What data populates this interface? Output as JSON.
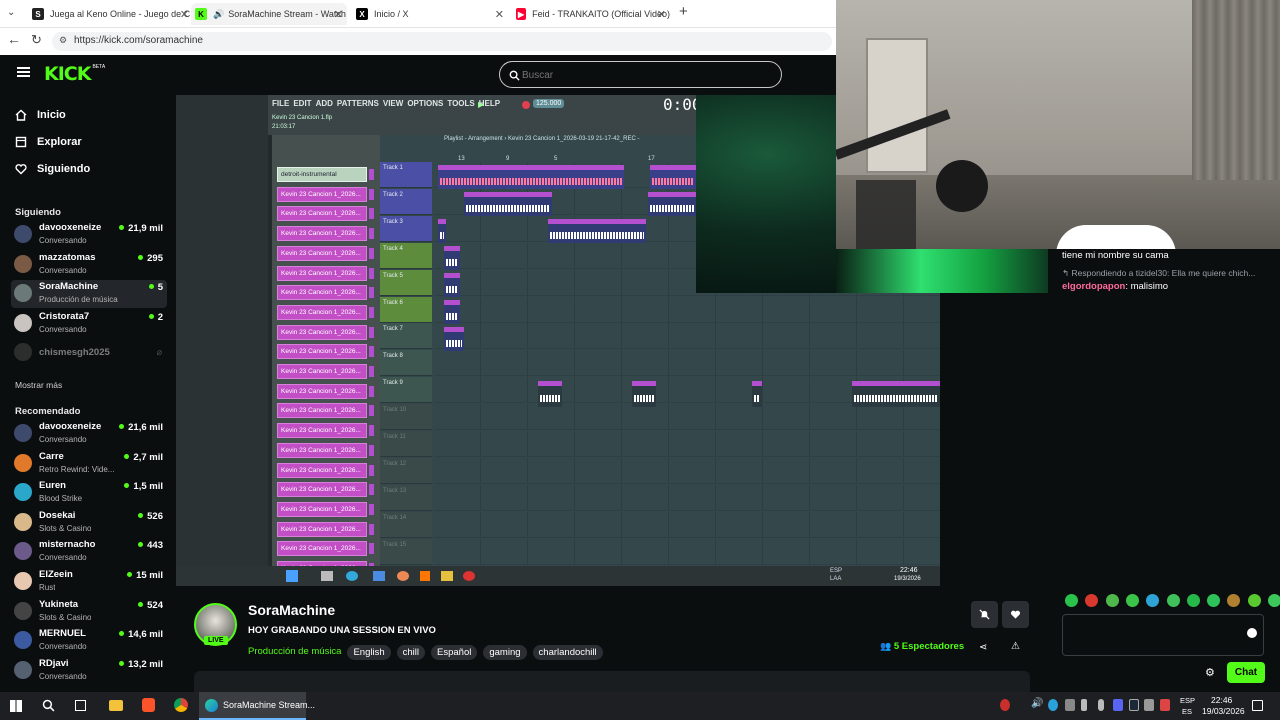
{
  "browser": {
    "tabs": [
      {
        "title": "Juega al Keno Online - Juego de C",
        "favicon_color": "#222222",
        "active": false
      },
      {
        "title": "SoraMachine Stream - Watch",
        "favicon_color": "#53fc18",
        "active": true
      },
      {
        "title": "Inicio / X",
        "favicon_color": "#000000",
        "active": false
      },
      {
        "title": "Feid - TRANKAITO (Official Video)",
        "favicon_color": "#ff0033",
        "active": false
      }
    ],
    "url": "https://kick.com/soramachine",
    "new_tab_icon": "plus-icon"
  },
  "kick": {
    "logo": "KICK",
    "logo_badge": "BETA",
    "search_placeholder": "Buscar",
    "accent": "#53fc18"
  },
  "sidebar": {
    "nav": [
      {
        "label": "Inicio",
        "icon": "home-icon"
      },
      {
        "label": "Explorar",
        "icon": "compass-icon"
      },
      {
        "label": "Siguiendo",
        "icon": "heart-icon"
      }
    ],
    "following_title": "Siguiendo",
    "following": [
      {
        "name": "davooxeneize",
        "sub": "Conversando",
        "count": "21,9 mil",
        "avatar_color": "#3d4a6b"
      },
      {
        "name": "mazzatomas",
        "sub": "Conversando",
        "count": "295",
        "avatar_color": "#7a5a44"
      },
      {
        "name": "SoraMachine",
        "sub": "Producción de música",
        "count": "5",
        "avatar_color": "#6b7a78",
        "selected": true
      },
      {
        "name": "Cristorata7",
        "sub": "Conversando",
        "count": "2",
        "avatar_color": "#c9c4c0"
      },
      {
        "name": "chismesgh2025",
        "sub": "",
        "count": "",
        "avatar_color": "#555555",
        "offline": true
      }
    ],
    "show_more": "Mostrar más",
    "recommended_title": "Recomendado",
    "recommended": [
      {
        "name": "davooxeneize",
        "sub": "Conversando",
        "count": "21,6 mil",
        "avatar_color": "#3d4a6b"
      },
      {
        "name": "Carre",
        "sub": "Retro Rewind: Vide...",
        "count": "2,7 mil",
        "avatar_color": "#e07a2a"
      },
      {
        "name": "Euren",
        "sub": "Blood Strike",
        "count": "1,5 mil",
        "avatar_color": "#2aa7c9"
      },
      {
        "name": "Dosekai",
        "sub": "Slots & Casino",
        "count": "526",
        "avatar_color": "#d9b98a"
      },
      {
        "name": "misternacho",
        "sub": "Conversando",
        "count": "443",
        "avatar_color": "#6b5a8a"
      },
      {
        "name": "ElZeein",
        "sub": "Rust",
        "count": "15 mil",
        "avatar_color": "#e8c8b0"
      },
      {
        "name": "Yukineta",
        "sub": "Slots & Casino",
        "count": "524",
        "avatar_color": "#444444"
      },
      {
        "name": "MERNUEL",
        "sub": "Conversando",
        "count": "14,6 mil",
        "avatar_color": "#3b5aa0"
      },
      {
        "name": "RDjavi",
        "sub": "Conversando",
        "count": "13,2 mil",
        "avatar_color": "#556070"
      }
    ]
  },
  "daw": {
    "menu": [
      "FILE",
      "EDIT",
      "ADD",
      "PATTERNS",
      "VIEW",
      "OPTIONS",
      "TOOLS",
      "HELP"
    ],
    "project": "Kevin 23 Cancion 1.flp",
    "time_small": "21:03:17",
    "tempo": "125.000",
    "time": "0:00:0",
    "playlist_title": "Playlist - Arrangement › Kevin 23 Cancion 1_2026-03-19 21-17-42_REC -",
    "channel_top": "detroit-instrumental",
    "channel_clip": "Kevin 23 Cancion 1_2026...",
    "tracks": [
      "Track 1",
      "Track 2",
      "Track 3",
      "Track 4",
      "Track 5",
      "Track 6",
      "Track 7",
      "Track 8",
      "Track 9",
      "Track 10",
      "Track 11",
      "Track 12",
      "Track 13",
      "Track 14",
      "Track 15"
    ],
    "clip_labels": [
      "detroit-instrumental 2025 [1]",
      "Kevin 23 Cancion...19 21-17-48_REC",
      "Kevin 23 Cancion 1...03-19 21-28-46_REC",
      "Kevin 23 Ca...2-43-152_REC"
    ],
    "ruler": [
      "13",
      "9",
      "5",
      "17"
    ],
    "clock": "22:46",
    "date": "19/3/2026",
    "lang": "ESP",
    "lang2": "LAA"
  },
  "stream": {
    "name": "SoraMachine",
    "title": "HOY GRABANDO UNA SESSION EN VIVO",
    "category": "Producción de música",
    "tags": [
      "English",
      "chill",
      "Español",
      "gaming",
      "charlandochill"
    ],
    "viewers_count": "5",
    "viewers_label": "Espectadores",
    "live": "LIVE"
  },
  "chat": {
    "messages": [
      {
        "type": "text",
        "text": "tiene mi nombre su cama"
      },
      {
        "type": "reply",
        "text": "Respondiendo a tizidel30: Ella me quiere chich..."
      },
      {
        "type": "message",
        "user": "elgordopapon",
        "user_color": "#ff6b9a",
        "text": "malisimo"
      }
    ],
    "emotes": [
      "#29c24a",
      "#d8382e",
      "#4fb84a",
      "#3bc44a",
      "#2ea3d6",
      "#3fc05a",
      "#27b84a",
      "#2dc25a",
      "#b08030",
      "#5ac830",
      "#3cc85a"
    ],
    "send_label": "Chat"
  },
  "taskbar": {
    "app_label": "SoraMachine Stream...",
    "lang": "ESP",
    "lang2": "ES",
    "time": "22:46",
    "date": "19/03/2026"
  }
}
